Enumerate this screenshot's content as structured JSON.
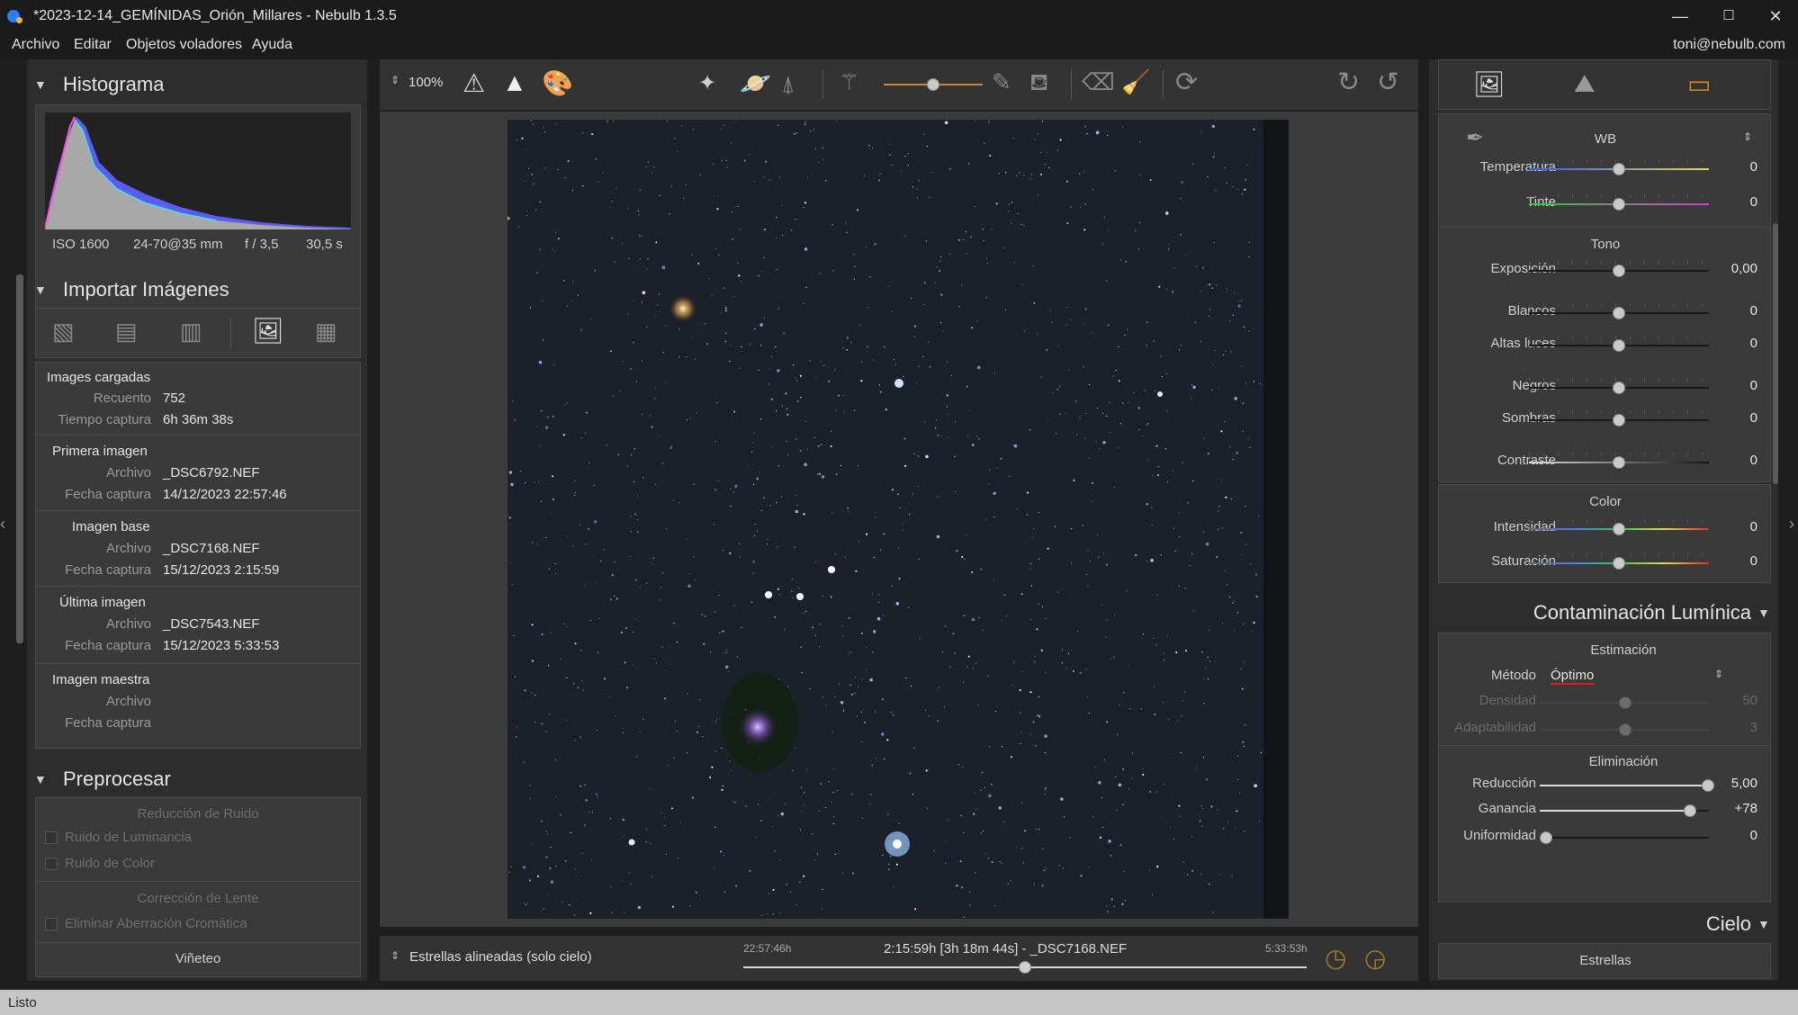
{
  "window": {
    "title": "*2023-12-14_GEMÍNIDAS_Orión_Millares - Nebulb 1.3.5",
    "minimize": "—",
    "maximize": "☐",
    "close": "✕"
  },
  "menu": {
    "items": [
      "Archivo",
      "Editar",
      "Objetos voladores",
      "Ayuda"
    ],
    "user": "toni@nebulb.com"
  },
  "left": {
    "histogram": {
      "title": "Histograma",
      "iso": "ISO 1600",
      "lens": "24-70@35 mm",
      "aperture": "f / 3,5",
      "exposure": "30,5 s"
    },
    "import": {
      "title": "Importar Imágenes",
      "loaded": {
        "header": "Images cargadas",
        "count_label": "Recuento",
        "count": "752",
        "time_label": "Tiempo captura",
        "time": "6h 36m 38s"
      },
      "first": {
        "header": "Primera imagen",
        "file_label": "Archivo",
        "file": "_DSC6792.NEF",
        "date_label": "Fecha captura",
        "date": "14/12/2023 22:57:46"
      },
      "base": {
        "header": "Imagen base",
        "file_label": "Archivo",
        "file": "_DSC7168.NEF",
        "date_label": "Fecha captura",
        "date": "15/12/2023 2:15:59"
      },
      "last": {
        "header": "Última imagen",
        "file_label": "Archivo",
        "file": "_DSC7543.NEF",
        "date_label": "Fecha captura",
        "date": "15/12/2023 5:33:53"
      },
      "master": {
        "header": "Imagen maestra",
        "file_label": "Archivo",
        "date_label": "Fecha captura"
      }
    },
    "preprocess": {
      "title": "Preprocesar",
      "noise_header": "Reducción de Ruido",
      "luminance": "Ruido de Luminancia",
      "color": "Ruido de Color",
      "lens_header": "Corrección de Lente",
      "chromatic": "Eliminar Aberración Cromática",
      "vignette": "Viñeteo"
    }
  },
  "toolbar": {
    "zoom": "100%"
  },
  "bottom": {
    "mode": "Estrellas alineadas (solo cielo)",
    "start": "22:57:46h",
    "current": "2:15:59h [3h 18m 44s] - _DSC7168.NEF",
    "end": "5:33:53h",
    "position": 0.5
  },
  "right": {
    "wb": {
      "title": "WB",
      "temp_label": "Temperatura",
      "temp": "0",
      "tint_label": "Tinte",
      "tint": "0"
    },
    "tone": {
      "title": "Tono",
      "exposure_label": "Exposición",
      "exposure": "0,00",
      "whites_label": "Blancos",
      "whites": "0",
      "highlights_label": "Altas luces",
      "highlights": "0",
      "blacks_label": "Negros",
      "blacks": "0",
      "shadows_label": "Sombras",
      "shadows": "0",
      "contrast_label": "Contraste",
      "contrast": "0"
    },
    "color": {
      "title": "Color",
      "intensity_label": "Intensidad",
      "intensity": "0",
      "saturation_label": "Saturación",
      "saturation": "0"
    },
    "lightpollution": {
      "title": "Contaminación Lumínica",
      "estimation": "Estimación",
      "method_label": "Método",
      "method": "Óptimo",
      "density_label": "Densidad",
      "density": "50",
      "adapt_label": "Adaptabilidad",
      "adapt": "3",
      "elimination": "Eliminación",
      "reduction_label": "Reducción",
      "reduction": "5,00",
      "gain_label": "Ganancia",
      "gain": "+78",
      "uniformity_label": "Uniformidad",
      "uniformity": "0"
    },
    "sky": {
      "title": "Cielo",
      "stars": "Estrellas"
    }
  },
  "status": "Listo"
}
